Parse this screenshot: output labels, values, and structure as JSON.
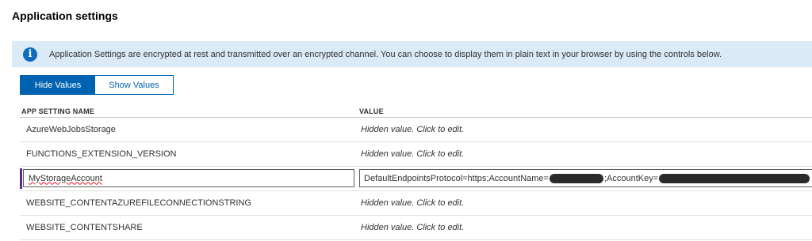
{
  "title": "Application settings",
  "info": {
    "icon": "info-icon",
    "text": "Application Settings are encrypted at rest and transmitted over an encrypted channel. You can choose to display them in plain text in your browser by using the controls below."
  },
  "toggle": {
    "hide_label": "Hide Values",
    "show_label": "Show Values",
    "selected": "Hide Values"
  },
  "table": {
    "headers": {
      "name": "APP SETTING NAME",
      "value": "VALUE"
    },
    "rows": [
      {
        "name": "AzureWebJobsStorage",
        "value": "Hidden value. Click to edit."
      },
      {
        "name": "FUNCTIONS_EXTENSION_VERSION",
        "value": "Hidden value. Click to edit."
      },
      {
        "name": "MyStorageAccount",
        "value_prefix": "DefaultEndpointsProtocol=https;AccountName=",
        "value_middle": ";AccountKey=",
        "editing": true
      },
      {
        "name": "WEBSITE_CONTENTAZUREFILECONNECTIONSTRING",
        "value": "Hidden value. Click to edit."
      },
      {
        "name": "WEBSITE_CONTENTSHARE",
        "value": "Hidden value. Click to edit."
      }
    ]
  },
  "colors": {
    "accent": "#0063b1",
    "info_bg": "#daeaf6",
    "edit_marker": "#5c2d91"
  }
}
